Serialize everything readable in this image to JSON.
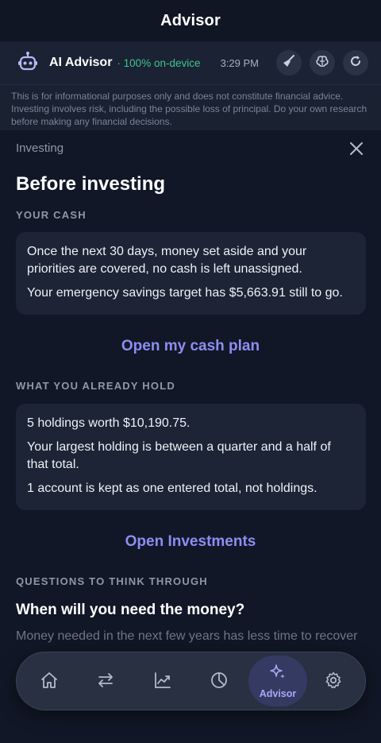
{
  "header": {
    "title": "Advisor"
  },
  "advisor_bar": {
    "name": "AI Advisor",
    "status": "· 100% on-device",
    "time": "3:29 PM",
    "icons": [
      "robot-icon",
      "broom-icon",
      "brain-icon",
      "refresh-icon"
    ]
  },
  "disclaimer": "This is for informational purposes only and does not constitute financial advice. Investing involves risk, including the possible loss of principal. Do your own research before making any financial decisions.",
  "sheet": {
    "label": "Investing",
    "title": "Before investing",
    "cash_section": {
      "label": "YOUR CASH",
      "lines": [
        "Once the next 30 days, money set aside and your priorities are covered, no cash is left unassigned.",
        "Your emergency savings target has $5,663.91 still to go."
      ],
      "link": "Open my cash plan"
    },
    "hold_section": {
      "label": "WHAT YOU ALREADY HOLD",
      "lines": [
        "5 holdings worth $10,190.75.",
        "Your largest holding is between a quarter and a half of that total.",
        "1 account is kept as one entered total, not holdings."
      ],
      "link": "Open Investments"
    },
    "questions_section": {
      "label": "QUESTIONS TO THINK THROUGH",
      "question": "When will you need the money?",
      "answer_preview": "Money needed in the next few years has less time to recover"
    }
  },
  "tabbar": {
    "tabs": [
      {
        "icon": "home-icon"
      },
      {
        "icon": "transfer-icon"
      },
      {
        "icon": "trend-icon"
      },
      {
        "icon": "pie-chart-icon"
      },
      {
        "icon": "sparkle-icon",
        "label": "Advisor",
        "active": true
      },
      {
        "icon": "gear-icon"
      }
    ]
  },
  "colors": {
    "accent": "#8d8df2",
    "status_green": "#3fc58d",
    "background": "#111726"
  }
}
